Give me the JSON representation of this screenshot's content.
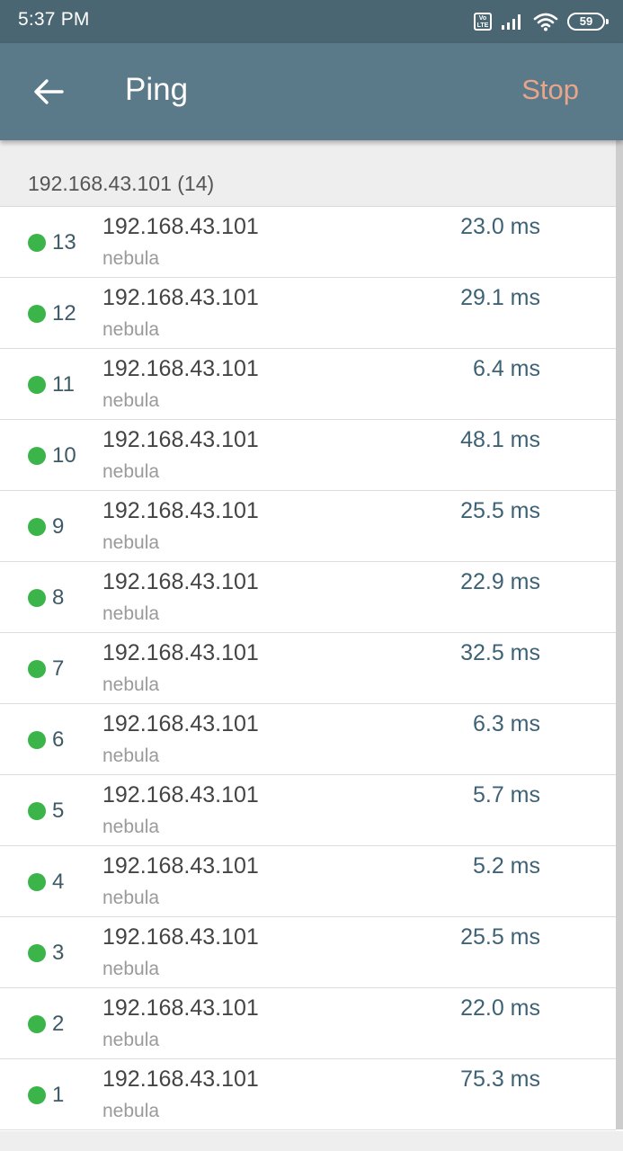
{
  "status_bar": {
    "time": "5:37 PM",
    "volte_label": "Vo LTE",
    "battery_level": "59",
    "icons": [
      "volte-icon",
      "signal-icon",
      "wifi-icon",
      "battery-icon"
    ]
  },
  "toolbar": {
    "back_icon": "arrow-left-icon",
    "title": "Ping",
    "stop_label": "Stop",
    "colors": {
      "background": "#5a7a89",
      "stop": "#e9a58c"
    }
  },
  "group": {
    "header": "192.168.43.101 (14)"
  },
  "status_color": "#3bb54a",
  "rows": [
    {
      "seq": "13",
      "ip": "192.168.43.101",
      "host": "nebula",
      "latency": "23.0 ms"
    },
    {
      "seq": "12",
      "ip": "192.168.43.101",
      "host": "nebula",
      "latency": "29.1 ms"
    },
    {
      "seq": "11",
      "ip": "192.168.43.101",
      "host": "nebula",
      "latency": "6.4 ms"
    },
    {
      "seq": "10",
      "ip": "192.168.43.101",
      "host": "nebula",
      "latency": "48.1 ms"
    },
    {
      "seq": "9",
      "ip": "192.168.43.101",
      "host": "nebula",
      "latency": "25.5 ms"
    },
    {
      "seq": "8",
      "ip": "192.168.43.101",
      "host": "nebula",
      "latency": "22.9 ms"
    },
    {
      "seq": "7",
      "ip": "192.168.43.101",
      "host": "nebula",
      "latency": "32.5 ms"
    },
    {
      "seq": "6",
      "ip": "192.168.43.101",
      "host": "nebula",
      "latency": "6.3 ms"
    },
    {
      "seq": "5",
      "ip": "192.168.43.101",
      "host": "nebula",
      "latency": "5.7 ms"
    },
    {
      "seq": "4",
      "ip": "192.168.43.101",
      "host": "nebula",
      "latency": "5.2 ms"
    },
    {
      "seq": "3",
      "ip": "192.168.43.101",
      "host": "nebula",
      "latency": "25.5 ms"
    },
    {
      "seq": "2",
      "ip": "192.168.43.101",
      "host": "nebula",
      "latency": "22.0 ms"
    },
    {
      "seq": "1",
      "ip": "192.168.43.101",
      "host": "nebula",
      "latency": "75.3 ms"
    }
  ]
}
